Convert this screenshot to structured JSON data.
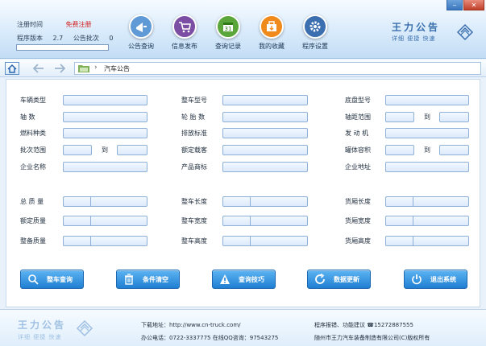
{
  "header": {
    "info": {
      "reg_time_label": "注册时间",
      "reg_link": "免费注册",
      "version_label": "程序版本",
      "version": "2.7",
      "batch_label": "公告批次",
      "batch": "0"
    },
    "nav": [
      {
        "label": "公告查询",
        "icon": "announcement-icon",
        "color": "#5f9ad6"
      },
      {
        "label": "信息发布",
        "icon": "cart-icon",
        "color": "#7b4ea3"
      },
      {
        "label": "查询记录",
        "icon": "calendar-icon",
        "color": "#5aa63a"
      },
      {
        "label": "我的收藏",
        "icon": "favorites-icon",
        "color": "#f08a1c"
      },
      {
        "label": "程序设置",
        "icon": "gear-icon",
        "color": "#3c6fb0"
      }
    ],
    "brand": {
      "title": "王力公告",
      "subtitle": "详细 便捷 快速"
    }
  },
  "toolbar": {
    "path": "汽车公告"
  },
  "form": {
    "vehicle_type": "车辆类型",
    "vehicle_model": "整车型号",
    "chassis_model": "底盘型号",
    "axle": "轴    数",
    "tires": "轮 胎 数",
    "wheelbase": "轴距范围",
    "fuel": "燃料种类",
    "emission": "排放标准",
    "engine": "发 动 机",
    "batch_range": "批次范围",
    "rated_pass": "额定载客",
    "body_vol": "罐体容积",
    "company": "企业名称",
    "trademark": "产品商标",
    "address": "企业地址",
    "to": "到",
    "total_mass": "总 质 量",
    "veh_length": "整车长度",
    "box_length": "货厢长度",
    "rated_mass": "额定质量",
    "veh_width": "整车宽度",
    "box_width": "货厢宽度",
    "curb_mass": "整备质量",
    "veh_height": "整车高度",
    "box_height": "货厢高度"
  },
  "buttons": [
    {
      "label": "整车查询",
      "icon": "search-icon"
    },
    {
      "label": "条件清空",
      "icon": "trash-icon"
    },
    {
      "label": "查询技巧",
      "icon": "warning-icon"
    },
    {
      "label": "数据更新",
      "icon": "refresh-icon"
    },
    {
      "label": "退出系统",
      "icon": "power-icon"
    }
  ],
  "footer": {
    "brand_title": "王力公告",
    "brand_sub": "详细 便捷 快速",
    "download": "下载地址：http://www.cn-truck.com/",
    "phone": "办公电话：0722-3337775  在线QQ咨询：97543275",
    "report": "程序报错、功能建议  ☎15272887555",
    "copyright": "随州市王力汽车装备制造有限公司(C)版权所有"
  }
}
